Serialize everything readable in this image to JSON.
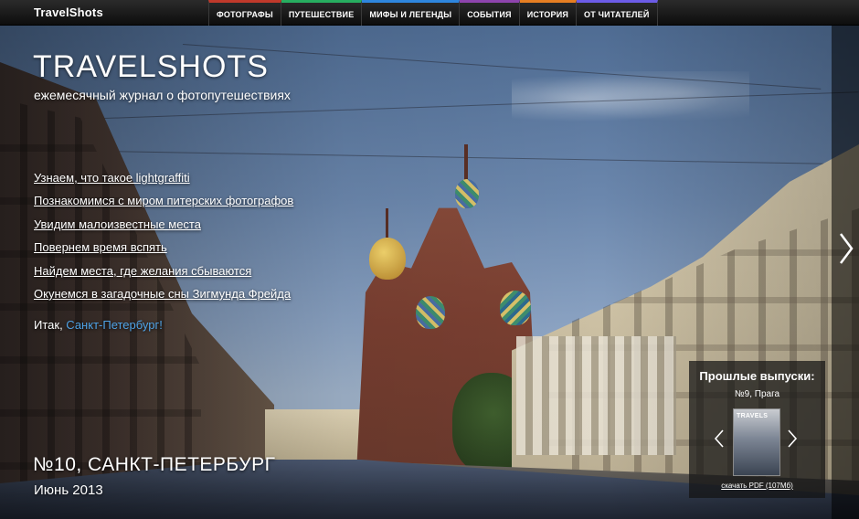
{
  "brand": "TravelShots",
  "nav": [
    {
      "label": "Фотографы",
      "color": "#c0392b"
    },
    {
      "label": "Путешествие",
      "color": "#27ae60"
    },
    {
      "label": "Мифы и легенды",
      "color": "#2e86de"
    },
    {
      "label": "События",
      "color": "#8e44ad"
    },
    {
      "label": "История",
      "color": "#e67e22"
    },
    {
      "label": "От читателей",
      "color": "#6c5ce7"
    }
  ],
  "hero": {
    "title": "TRAVELSHOTS",
    "tagline": "ежемесячный журнал о фотопутешествиях",
    "links": [
      "Узнаем, что такое lightgraffiti",
      "Познакомимся с миром питерских фотографов",
      "Увидим малоизвестные места",
      "Повернем время вспять",
      "Найдем места, где желания сбываются",
      "Окунемся в загадочные сны Зигмунда Фрейда"
    ],
    "itak_prefix": "Итак, ",
    "itak_city": "Санкт-Петербург!",
    "issue_title": "№10, САНКТ-ПЕТЕРБУРГ",
    "issue_date": "Июнь 2013"
  },
  "past_issues": {
    "title": "Прошлые выпуски:",
    "current": "№9, Прага",
    "cover_text": "TRAVELS",
    "download": "скачать PDF (107Мб)"
  },
  "accent": {
    "link_blue": "#4fa3e6"
  }
}
